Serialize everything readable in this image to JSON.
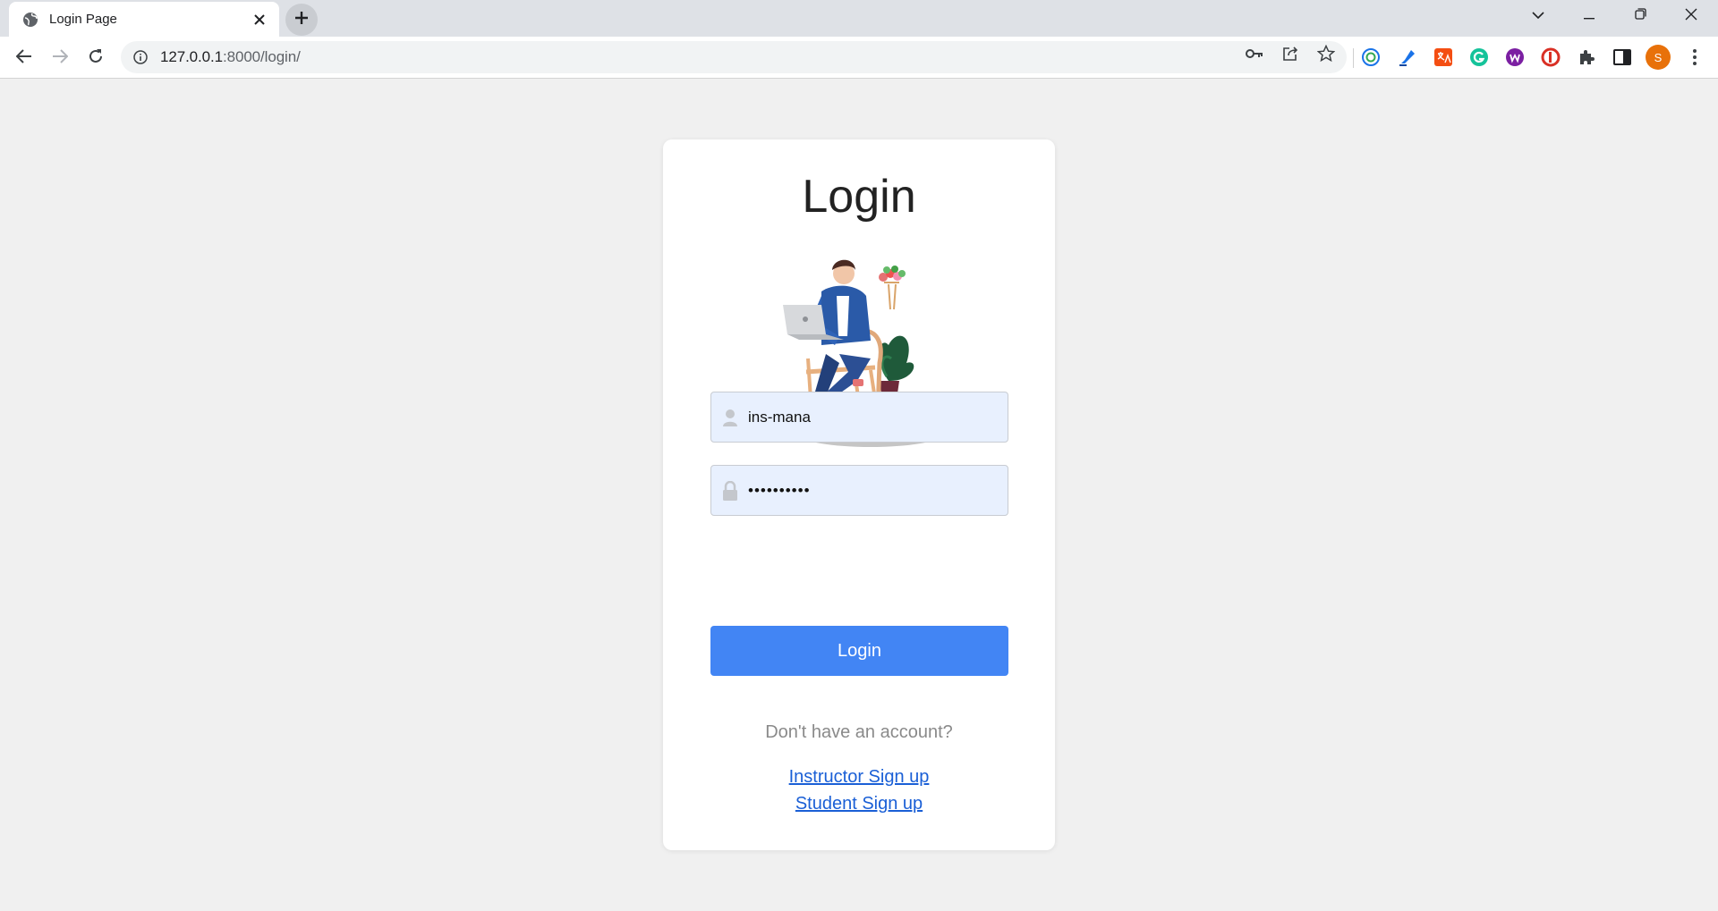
{
  "browser": {
    "tab_title": "Login Page",
    "url_host": "127.0.0.1",
    "url_rest": ":8000/login/",
    "profile_initial": "S",
    "colors": {
      "accent_profile": "#e8710a"
    }
  },
  "login": {
    "title": "Login",
    "username_value": "ins-mana",
    "password_mask": "••••••••••",
    "button_label": "Login",
    "signup_prompt": "Don't have an account?",
    "instructor_signup": "Instructor Sign up",
    "student_signup": "Student Sign up",
    "colors": {
      "button": "#4285f4",
      "link": "#1a5fd6",
      "field_bg": "#e8f0fe"
    }
  },
  "icons": [
    "globe-icon",
    "close-icon",
    "plus-icon",
    "chevron-down-icon",
    "minimize-icon",
    "restore-icon",
    "window-close-icon",
    "back-icon",
    "forward-icon",
    "reload-icon",
    "info-icon",
    "key-icon",
    "share-icon",
    "star-icon",
    "extensions-icon",
    "side-panel-icon",
    "menu-icon",
    "user-icon",
    "lock-icon"
  ]
}
